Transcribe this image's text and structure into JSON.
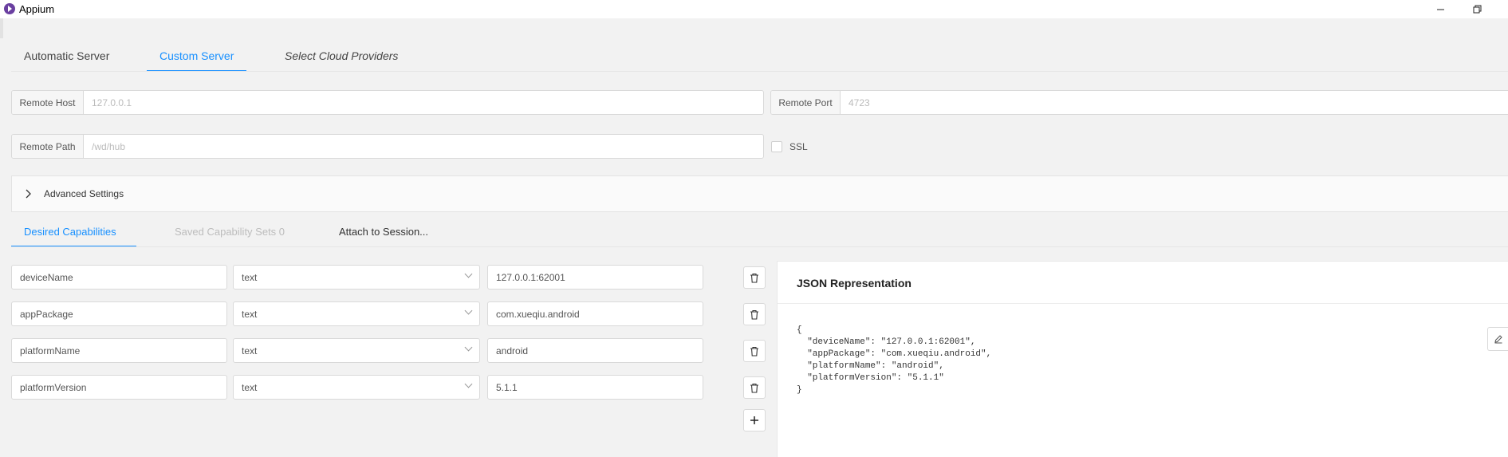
{
  "window": {
    "title": "Appium"
  },
  "server_tabs": [
    {
      "label": "Automatic Server"
    },
    {
      "label": "Custom Server"
    },
    {
      "label": "Select Cloud Providers"
    }
  ],
  "remote_host": {
    "label": "Remote Host",
    "placeholder": "127.0.0.1"
  },
  "remote_port": {
    "label": "Remote Port",
    "placeholder": "4723"
  },
  "remote_path": {
    "label": "Remote Path",
    "placeholder": "/wd/hub"
  },
  "ssl": {
    "label": "SSL",
    "checked": false
  },
  "advanced": {
    "label": "Advanced Settings"
  },
  "session_tabs": [
    {
      "label": "Desired Capabilities"
    },
    {
      "label": "Saved Capability Sets 0"
    },
    {
      "label": "Attach to Session..."
    }
  ],
  "capabilities": [
    {
      "name": "deviceName",
      "type": "text",
      "value": "127.0.0.1:62001"
    },
    {
      "name": "appPackage",
      "type": "text",
      "value": "com.xueqiu.android"
    },
    {
      "name": "platformName",
      "type": "text",
      "value": "android"
    },
    {
      "name": "platformVersion",
      "type": "text",
      "value": "5.1.1"
    }
  ],
  "json_panel": {
    "title": "JSON Representation",
    "code": "{\n  \"deviceName\": \"127.0.0.1:62001\",\n  \"appPackage\": \"com.xueqiu.android\",\n  \"platformName\": \"android\",\n  \"platformVersion\": \"5.1.1\"\n}"
  },
  "colors": {
    "accent": "#1890ff",
    "app_icon": "#6a3fa0"
  }
}
